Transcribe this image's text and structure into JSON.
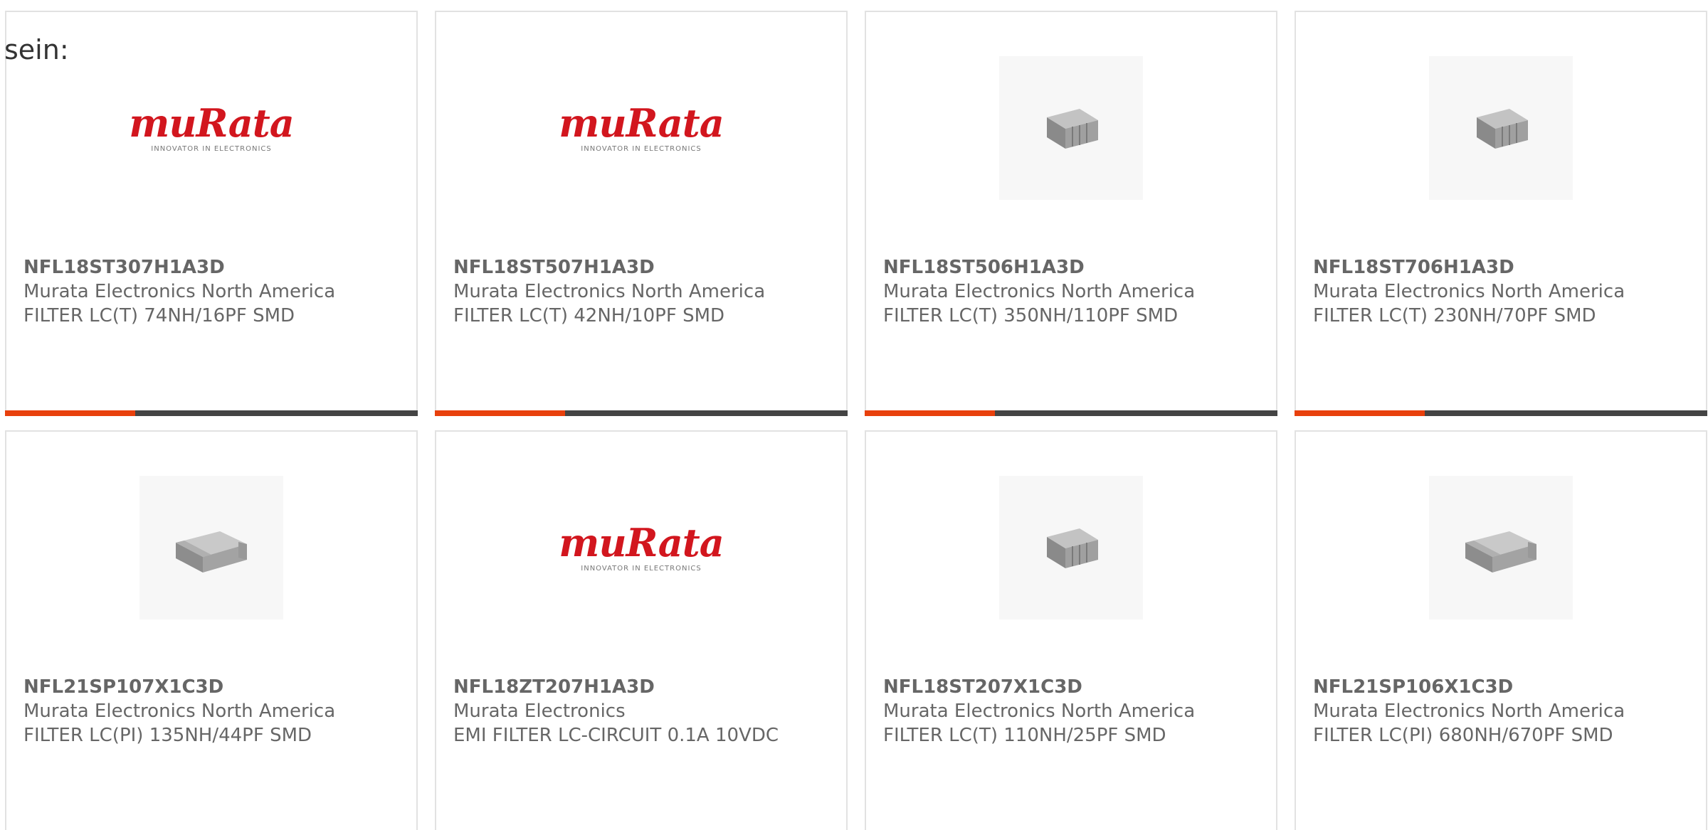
{
  "intro_text": "sein:",
  "colors": {
    "accent": "#e8400c",
    "bar": "#444444",
    "logo_red": "#d2161e"
  },
  "products": [
    {
      "part_number": "NFL18ST307H1A3D",
      "manufacturer": "Murata Electronics North America",
      "description": "FILTER LC(T) 74NH/16PF SMD",
      "image": "murata-logo"
    },
    {
      "part_number": "NFL18ST507H1A3D",
      "manufacturer": "Murata Electronics North America",
      "description": "FILTER LC(T) 42NH/10PF SMD",
      "image": "murata-logo"
    },
    {
      "part_number": "NFL18ST506H1A3D",
      "manufacturer": "Murata Electronics North America",
      "description": "FILTER LC(T) 350NH/110PF SMD",
      "image": "smd-chip-component"
    },
    {
      "part_number": "NFL18ST706H1A3D",
      "manufacturer": "Murata Electronics North America",
      "description": "FILTER LC(T) 230NH/70PF SMD",
      "image": "smd-chip-component"
    },
    {
      "part_number": "NFL21SP107X1C3D",
      "manufacturer": "Murata Electronics North America",
      "description": "FILTER LC(PI) 135NH/44PF SMD",
      "image": "smd-chip-component-flat"
    },
    {
      "part_number": "NFL18ZT207H1A3D",
      "manufacturer": "Murata Electronics",
      "description": "EMI FILTER LC-CIRCUIT 0.1A 10VDC",
      "image": "murata-logo"
    },
    {
      "part_number": "NFL18ST207X1C3D",
      "manufacturer": "Murata Electronics North America",
      "description": "FILTER LC(T) 110NH/25PF SMD",
      "image": "smd-chip-component"
    },
    {
      "part_number": "NFL21SP106X1C3D",
      "manufacturer": "Murata Electronics North America",
      "description": "FILTER LC(PI) 680NH/670PF SMD",
      "image": "smd-chip-component-flat"
    }
  ],
  "logo": {
    "wordmark": "muRata",
    "tagline": "INNOVATOR IN ELECTRONICS"
  }
}
